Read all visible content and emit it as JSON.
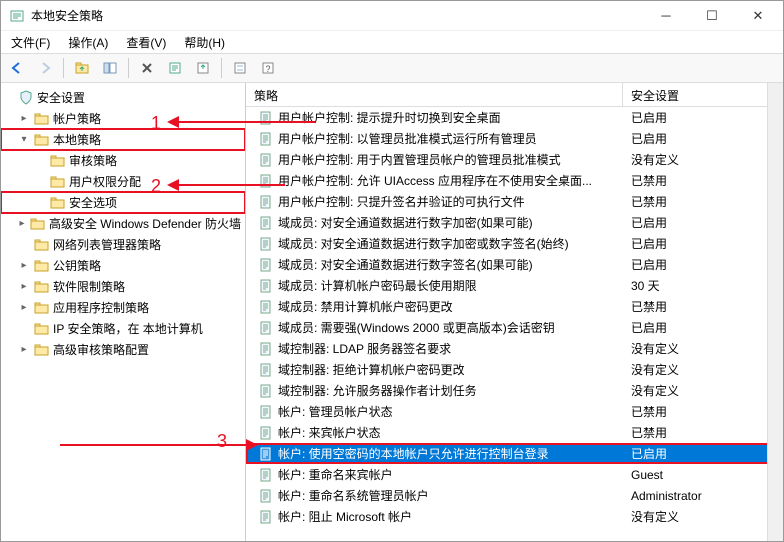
{
  "window": {
    "title": "本地安全策略"
  },
  "menu": {
    "file": "文件(F)",
    "action": "操作(A)",
    "view": "查看(V)",
    "help": "帮助(H)"
  },
  "columns": {
    "policy": "策略",
    "setting": "安全设置"
  },
  "tree": {
    "root": "安全设置",
    "items": [
      {
        "label": "帐户策略",
        "depth": 1,
        "expand": "closed"
      },
      {
        "label": "本地策略",
        "depth": 1,
        "expand": "open",
        "box": true
      },
      {
        "label": "审核策略",
        "depth": 2,
        "expand": "none"
      },
      {
        "label": "用户权限分配",
        "depth": 2,
        "expand": "none"
      },
      {
        "label": "安全选项",
        "depth": 2,
        "expand": "none",
        "box": true
      },
      {
        "label": "高级安全 Windows Defender 防火墙",
        "depth": 1,
        "expand": "closed"
      },
      {
        "label": "网络列表管理器策略",
        "depth": 1,
        "expand": "none"
      },
      {
        "label": "公钥策略",
        "depth": 1,
        "expand": "closed"
      },
      {
        "label": "软件限制策略",
        "depth": 1,
        "expand": "closed"
      },
      {
        "label": "应用程序控制策略",
        "depth": 1,
        "expand": "closed"
      },
      {
        "label": "IP 安全策略，在 本地计算机",
        "depth": 1,
        "expand": "none"
      },
      {
        "label": "高级审核策略配置",
        "depth": 1,
        "expand": "closed"
      }
    ]
  },
  "policies": [
    {
      "name": "用户帐户控制: 提示提升时切换到安全桌面",
      "setting": "已启用"
    },
    {
      "name": "用户帐户控制: 以管理员批准模式运行所有管理员",
      "setting": "已启用"
    },
    {
      "name": "用户帐户控制: 用于内置管理员帐户的管理员批准模式",
      "setting": "没有定义"
    },
    {
      "name": "用户帐户控制: 允许 UIAccess 应用程序在不使用安全桌面...",
      "setting": "已禁用"
    },
    {
      "name": "用户帐户控制: 只提升签名并验证的可执行文件",
      "setting": "已禁用"
    },
    {
      "name": "域成员: 对安全通道数据进行数字加密(如果可能)",
      "setting": "已启用"
    },
    {
      "name": "域成员: 对安全通道数据进行数字加密或数字签名(始终)",
      "setting": "已启用"
    },
    {
      "name": "域成员: 对安全通道数据进行数字签名(如果可能)",
      "setting": "已启用"
    },
    {
      "name": "域成员: 计算机帐户密码最长使用期限",
      "setting": "30 天"
    },
    {
      "name": "域成员: 禁用计算机帐户密码更改",
      "setting": "已禁用"
    },
    {
      "name": "域成员: 需要强(Windows 2000 或更高版本)会话密钥",
      "setting": "已启用"
    },
    {
      "name": "域控制器: LDAP 服务器签名要求",
      "setting": "没有定义"
    },
    {
      "name": "域控制器: 拒绝计算机帐户密码更改",
      "setting": "没有定义"
    },
    {
      "name": "域控制器: 允许服务器操作者计划任务",
      "setting": "没有定义"
    },
    {
      "name": "帐户: 管理员帐户状态",
      "setting": "已禁用"
    },
    {
      "name": "帐户: 来宾帐户状态",
      "setting": "已禁用"
    },
    {
      "name": "帐户: 使用空密码的本地帐户只允许进行控制台登录",
      "setting": "已启用",
      "selected": true,
      "box": true
    },
    {
      "name": "帐户: 重命名来宾帐户",
      "setting": "Guest"
    },
    {
      "name": "帐户: 重命名系统管理员帐户",
      "setting": "Administrator"
    },
    {
      "name": "帐户: 阻止 Microsoft 帐户",
      "setting": "没有定义"
    }
  ],
  "annotations": {
    "n1": "1",
    "n2": "2",
    "n3": "3"
  },
  "toolbar_icons": [
    "back-icon",
    "forward-icon",
    "up-icon",
    "show-hide-tree-icon",
    "delete-icon",
    "refresh-icon",
    "export-icon",
    "properties-icon",
    "help-icon"
  ]
}
